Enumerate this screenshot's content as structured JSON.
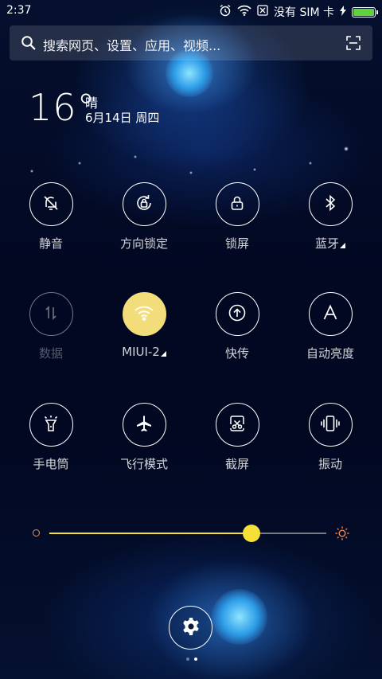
{
  "status_bar": {
    "time": "2:37",
    "sim_text": "没有 SIM 卡",
    "icons": [
      "alarm-icon",
      "wifi-icon",
      "no-sim-icon",
      "charging-icon",
      "battery-icon"
    ],
    "battery_color": "#5ed23f"
  },
  "search": {
    "placeholder": "搜索网页、设置、应用、视频..."
  },
  "weather": {
    "temperature": "16°",
    "condition": "晴",
    "date": "6月14日 周四"
  },
  "toggles": [
    {
      "label": "静音",
      "icon": "silent-bell-icon",
      "state": "off"
    },
    {
      "label": "方向锁定",
      "icon": "rotation-lock-icon",
      "state": "off"
    },
    {
      "label": "锁屏",
      "icon": "lock-icon",
      "state": "off"
    },
    {
      "label": "蓝牙",
      "icon": "bluetooth-icon",
      "state": "off",
      "has_submenu": true
    },
    {
      "label": "数据",
      "icon": "mobile-data-icon",
      "state": "disabled"
    },
    {
      "label": "MIUI-2",
      "icon": "wifi-icon",
      "state": "on",
      "has_submenu": true
    },
    {
      "label": "快传",
      "icon": "quick-transfer-icon",
      "state": "off"
    },
    {
      "label": "自动亮度",
      "icon": "auto-brightness-icon",
      "state": "off"
    },
    {
      "label": "手电筒",
      "icon": "flashlight-icon",
      "state": "off"
    },
    {
      "label": "飞行模式",
      "icon": "airplane-icon",
      "state": "off"
    },
    {
      "label": "截屏",
      "icon": "screenshot-icon",
      "state": "off"
    },
    {
      "label": "振动",
      "icon": "vibrate-icon",
      "state": "off"
    }
  ],
  "brightness": {
    "level": 0.73,
    "accent": "#f5e03a"
  },
  "accent_on": "#f3dd7a",
  "pager": {
    "pages": 2,
    "active": 2
  }
}
